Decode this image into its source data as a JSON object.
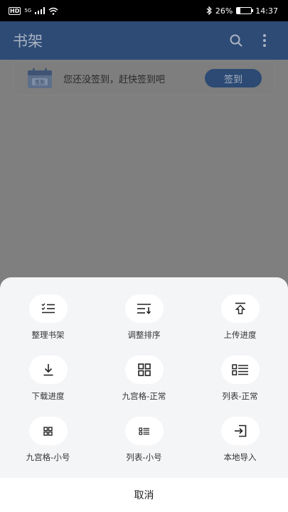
{
  "status_bar": {
    "network_badge": "HD",
    "signal_text": "5G",
    "battery_pct_label": "26%",
    "battery_level": 0.26,
    "time": "14:37"
  },
  "header": {
    "title": "书架"
  },
  "signin_card": {
    "message": "您还没签到，赶快签到吧",
    "button_label": "签到",
    "calendar_label": "签到"
  },
  "sheet": {
    "items": [
      {
        "label": "整理书架",
        "icon": "organize-list-icon"
      },
      {
        "label": "调整排序",
        "icon": "sort-icon"
      },
      {
        "label": "上传进度",
        "icon": "upload-icon"
      },
      {
        "label": "下载进度",
        "icon": "download-icon"
      },
      {
        "label": "九宫格-正常",
        "icon": "grid-large-icon"
      },
      {
        "label": "列表-正常",
        "icon": "list-large-icon"
      },
      {
        "label": "九宫格-小号",
        "icon": "grid-small-icon"
      },
      {
        "label": "列表-小号",
        "icon": "list-small-icon"
      },
      {
        "label": "本地导入",
        "icon": "import-icon"
      }
    ],
    "cancel_label": "取消"
  }
}
